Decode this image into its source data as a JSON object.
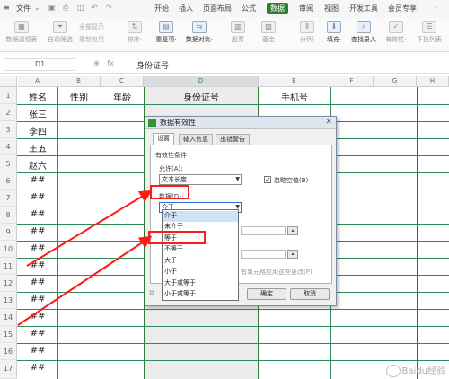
{
  "menu": {
    "file": "文件",
    "items": [
      "开始",
      "插入",
      "页面布局",
      "公式",
      "数据",
      "审阅",
      "视图",
      "开发工具",
      "会员专享"
    ],
    "active": "数据"
  },
  "ribbon": {
    "buttons": [
      {
        "icon": "pivot-table-icon",
        "label": "数据透视表"
      },
      {
        "icon": "auto-filter-icon",
        "label": "自动筛选"
      },
      {
        "icon": "sort-icon",
        "label": "排序·"
      },
      {
        "icon": "duplicate-icon",
        "label": "重复项·"
      },
      {
        "icon": "compare-icon",
        "label": "数据对比·"
      },
      {
        "icon": "stock-icon",
        "label": "股票"
      },
      {
        "icon": "fund-icon",
        "label": "基金"
      },
      {
        "icon": "split-icon",
        "label": "分列·"
      },
      {
        "icon": "fill-icon",
        "label": "填充·"
      },
      {
        "icon": "lookup-icon",
        "label": "查找录入"
      },
      {
        "icon": "validity-icon",
        "label": "有效性·"
      },
      {
        "icon": "dropdown-list-icon",
        "label": "下拉列表"
      }
    ],
    "filter_small": [
      "全部显示",
      "重新应用"
    ]
  },
  "formula_bar": {
    "cell_ref": "D1",
    "fx": "fx",
    "content": "身份证号"
  },
  "sheet": {
    "columns": [
      "A",
      "B",
      "C",
      "D",
      "E",
      "F",
      "G",
      "H"
    ],
    "selected_column": "D",
    "rows": [
      "1",
      "2",
      "3",
      "4",
      "5",
      "6",
      "7",
      "8",
      "9",
      "10",
      "11",
      "12",
      "13",
      "14",
      "15",
      "16",
      "17"
    ],
    "headers": {
      "A": "姓名",
      "B": "性别",
      "C": "年龄",
      "D": "身份证号",
      "E": "手机号"
    },
    "names": [
      "张三",
      "李四",
      "王五",
      "赵六",
      "##",
      "##",
      "##",
      "##",
      "##",
      "##",
      "##",
      "##",
      "##",
      "##",
      "##",
      "##"
    ]
  },
  "dialog": {
    "title": "数据有效性",
    "tabs": [
      "设置",
      "输入信息",
      "出错警告"
    ],
    "section": "有效性条件",
    "allow_label": "允许(A):",
    "allow_value": "文本长度",
    "ignore_blank": "忽略空值(B)",
    "data_label": "数据(D):",
    "data_value": "介于",
    "hint_tail": "有单元格应用这些更改(P)",
    "ok": "确定",
    "cancel": "取消",
    "options": [
      "介于",
      "未介于",
      "等于",
      "不等于",
      "大于",
      "小于",
      "大于或等于",
      "小于或等于"
    ],
    "highlighted": "介于"
  },
  "watermark": "Baidu经验",
  "colors": {
    "accent": "#2e7d32",
    "annotation": "#ff1a1a",
    "selection": "#ececec"
  }
}
